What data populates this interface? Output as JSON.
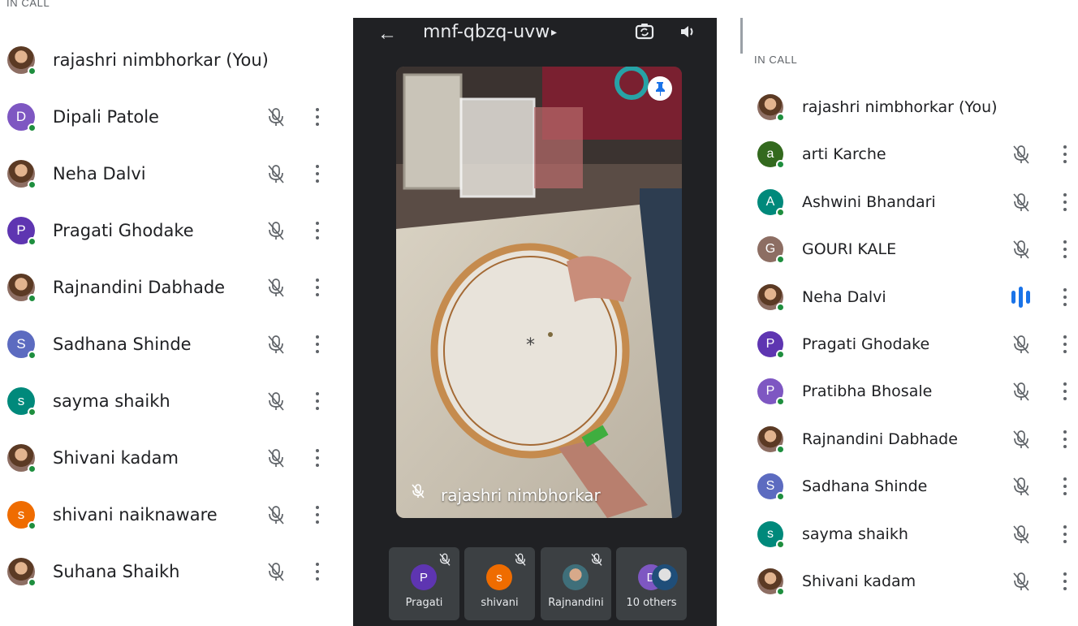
{
  "left_panel": {
    "section_label": "IN CALL",
    "participants": [
      {
        "name": "rajashri nimbhorkar (You)",
        "initial": "",
        "avatar": "photo",
        "color": "",
        "muted": false,
        "menu": false
      },
      {
        "name": "Dipali Patole",
        "initial": "D",
        "avatar": "letter",
        "color": "#7e57c2",
        "muted": true,
        "menu": true
      },
      {
        "name": "Neha Dalvi",
        "initial": "",
        "avatar": "photo",
        "color": "",
        "muted": true,
        "menu": true
      },
      {
        "name": "Pragati Ghodake",
        "initial": "P",
        "avatar": "letter",
        "color": "#5e35b1",
        "muted": true,
        "menu": true
      },
      {
        "name": "Rajnandini Dabhade",
        "initial": "",
        "avatar": "photo",
        "color": "",
        "muted": true,
        "menu": true
      },
      {
        "name": "Sadhana Shinde",
        "initial": "S",
        "avatar": "letter",
        "color": "#5c6bc0",
        "muted": true,
        "menu": true
      },
      {
        "name": "sayma shaikh",
        "initial": "s",
        "avatar": "letter",
        "color": "#00897b",
        "muted": true,
        "menu": true
      },
      {
        "name": "Shivani kadam",
        "initial": "",
        "avatar": "photo",
        "color": "",
        "muted": true,
        "menu": true
      },
      {
        "name": "shivani naiknaware",
        "initial": "s",
        "avatar": "letter",
        "color": "#ef6c00",
        "muted": true,
        "menu": true
      },
      {
        "name": "Suhana Shaikh",
        "initial": "",
        "avatar": "photo",
        "color": "",
        "muted": true,
        "menu": true
      }
    ]
  },
  "center": {
    "meeting_code": "mnf-qbzq-uvw",
    "caret": "▸",
    "back_icon": "arrow-left-icon",
    "flip_icon": "camera-flip-icon",
    "speaker_icon": "speaker-icon",
    "pin_icon": "pin-icon",
    "main_video_name": "rajashri nimbhorkar",
    "tiles": [
      {
        "label": "Pragati",
        "initial": "P",
        "color": "#5e35b1"
      },
      {
        "label": "shivani",
        "initial": "s",
        "color": "#ef6c00"
      },
      {
        "label": "Rajnandini",
        "initial": "",
        "color": ""
      },
      {
        "label": "10 others",
        "initial": "D",
        "color": "#7e57c2"
      }
    ]
  },
  "right_panel": {
    "section_label": "IN CALL",
    "participants": [
      {
        "name": "rajashri nimbhorkar (You)",
        "initial": "",
        "avatar": "photo",
        "color": "",
        "state": "none"
      },
      {
        "name": "arti Karche",
        "initial": "a",
        "avatar": "letter",
        "color": "#33691e",
        "state": "muted"
      },
      {
        "name": "Ashwini Bhandari",
        "initial": "A",
        "avatar": "letter",
        "color": "#00897b",
        "state": "muted"
      },
      {
        "name": "GOURI KALE",
        "initial": "G",
        "avatar": "letter",
        "color": "#8d6e63",
        "state": "muted"
      },
      {
        "name": "Neha Dalvi",
        "initial": "",
        "avatar": "photo",
        "color": "",
        "state": "speaking"
      },
      {
        "name": "Pragati Ghodake",
        "initial": "P",
        "avatar": "letter",
        "color": "#5e35b1",
        "state": "muted"
      },
      {
        "name": "Pratibha Bhosale",
        "initial": "P",
        "avatar": "letter",
        "color": "#7e57c2",
        "state": "muted"
      },
      {
        "name": "Rajnandini Dabhade",
        "initial": "",
        "avatar": "photo",
        "color": "",
        "state": "muted"
      },
      {
        "name": "Sadhana Shinde",
        "initial": "S",
        "avatar": "letter",
        "color": "#5c6bc0",
        "state": "muted"
      },
      {
        "name": "sayma shaikh",
        "initial": "s",
        "avatar": "letter",
        "color": "#00897b",
        "state": "muted"
      },
      {
        "name": "Shivani kadam",
        "initial": "",
        "avatar": "photo",
        "color": "",
        "state": "muted"
      }
    ]
  },
  "colors": {
    "online_dot": "#1e8e3e",
    "speaking_blue": "#1a73e8",
    "meet_dark": "#202124"
  }
}
